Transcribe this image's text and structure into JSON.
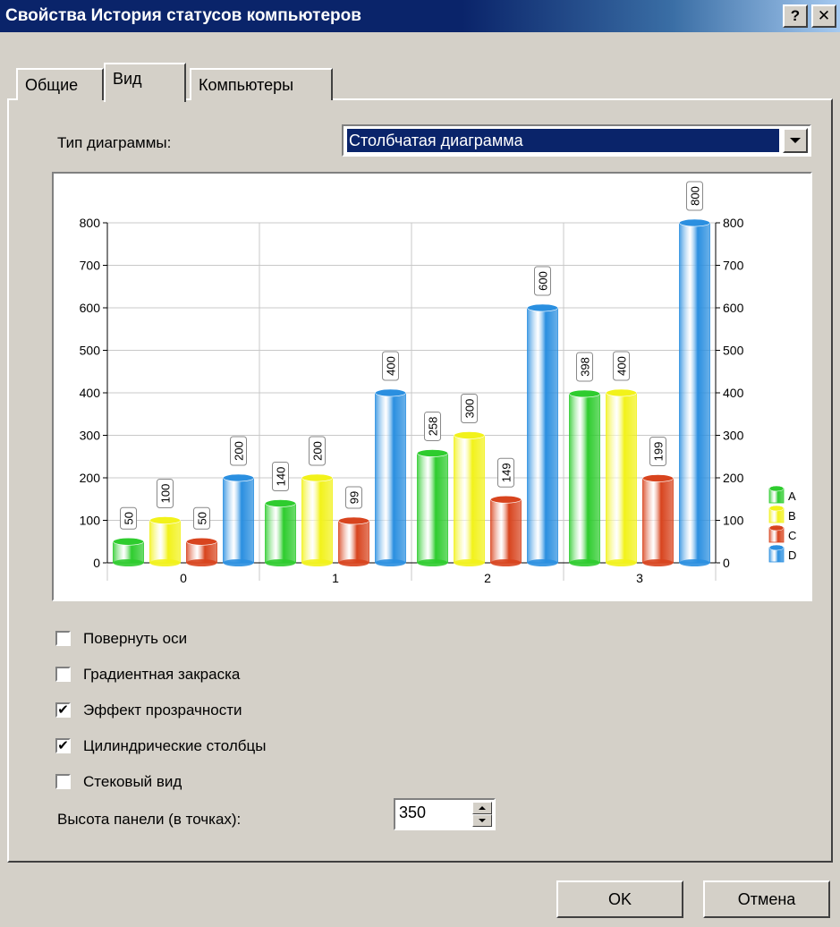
{
  "window": {
    "title": "Свойства История статусов компьютеров",
    "help_btn": "?",
    "close_btn": "✕"
  },
  "tabs": [
    {
      "label": "Общие",
      "active": false
    },
    {
      "label": "Вид",
      "active": true
    },
    {
      "label": "Компьютеры",
      "active": false
    }
  ],
  "chart_type": {
    "label": "Тип диаграммы:",
    "value": "Столбчатая диаграмма"
  },
  "options": [
    {
      "label": "Повернуть оси",
      "checked": false
    },
    {
      "label": "Градиентная закраска",
      "checked": false
    },
    {
      "label": "Эффект прозрачности",
      "checked": true
    },
    {
      "label": "Цилиндрические столбцы",
      "checked": true
    },
    {
      "label": "Стековый вид",
      "checked": false
    }
  ],
  "panel_height": {
    "label": "Высота панели (в точках):",
    "value": "350"
  },
  "buttons": {
    "ok": "OK",
    "cancel": "Отмена"
  },
  "colors": {
    "A": "#2ecc2e",
    "B": "#f2f21a",
    "C": "#d8441e",
    "D": "#2a8fe0"
  },
  "chart_data": {
    "type": "bar",
    "categories": [
      "0",
      "1",
      "2",
      "3"
    ],
    "series": [
      {
        "name": "A",
        "values": [
          50,
          140,
          258,
          398
        ]
      },
      {
        "name": "B",
        "values": [
          100,
          200,
          300,
          400
        ]
      },
      {
        "name": "C",
        "values": [
          50,
          99,
          149,
          199
        ]
      },
      {
        "name": "D",
        "values": [
          200,
          400,
          600,
          800
        ]
      }
    ],
    "y_ticks": [
      "0",
      "100",
      "200",
      "300",
      "400",
      "500",
      "600",
      "700",
      "800"
    ],
    "ylim": [
      0,
      800
    ],
    "grid": true,
    "legend": "right",
    "style": "cylinder"
  }
}
